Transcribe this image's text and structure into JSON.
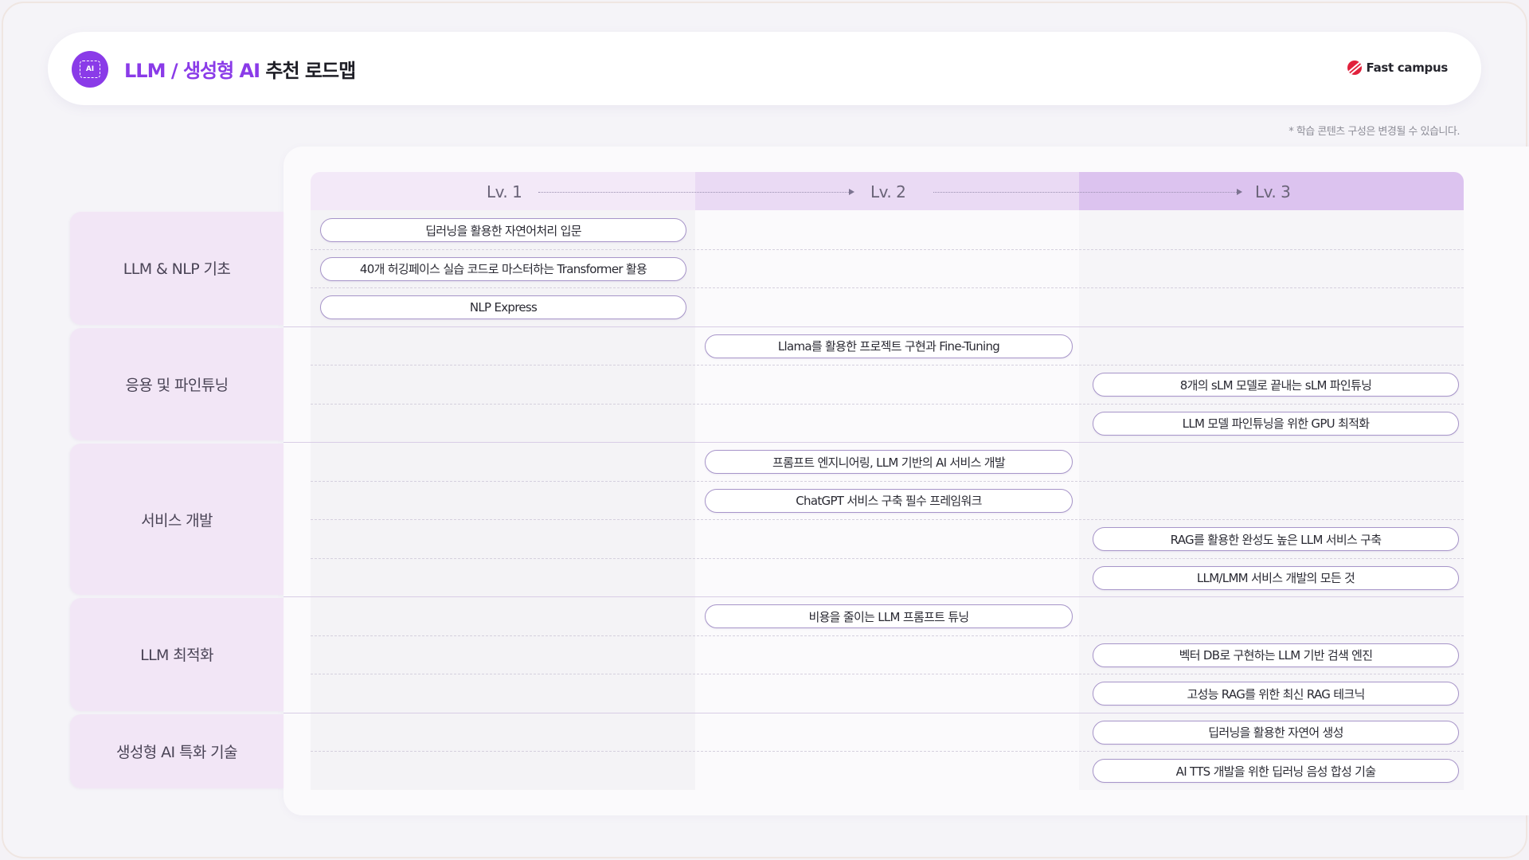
{
  "header": {
    "title_accent": "LLM / 생성형 AI",
    "title_rest": "추천 로드맵",
    "logo_text": "AI",
    "brand": "Fast campus"
  },
  "note": "* 학습 콘텐츠 구성은 변경될 수 있습니다.",
  "levels": [
    "Lv. 1",
    "Lv. 2",
    "Lv. 3"
  ],
  "categories": [
    {
      "label": "LLM & NLP 기초",
      "courses": [
        {
          "label": "딥러닝을 활용한 자연어처리 입문",
          "level": 1
        },
        {
          "label": "40개 허깅페이스 실습 코드로 마스터하는 Transformer 활용",
          "level": 1
        },
        {
          "label": "NLP Express",
          "level": 1
        }
      ]
    },
    {
      "label": "응용 및 파인튜닝",
      "courses": [
        {
          "label": "Llama를 활용한 프로젝트 구현과 Fine-Tuning",
          "level": 2
        },
        {
          "label": "8개의 sLM 모델로 끝내는 sLM 파인튜닝",
          "level": 3
        },
        {
          "label": "LLM 모델 파인튜닝을 위한 GPU 최적화",
          "level": 3
        }
      ]
    },
    {
      "label": "서비스 개발",
      "courses": [
        {
          "label": "프롬프트 엔지니어링, LLM 기반의 AI 서비스 개발",
          "level": 2
        },
        {
          "label": "ChatGPT 서비스 구축 필수 프레임워크",
          "level": 2
        },
        {
          "label": "RAG를 활용한 완성도 높은 LLM 서비스 구축",
          "level": 3
        },
        {
          "label": "LLM/LMM 서비스 개발의 모든 것",
          "level": 3
        }
      ]
    },
    {
      "label": "LLM 최적화",
      "courses": [
        {
          "label": "비용을 줄이는 LLM 프롬프트 튜닝",
          "level": 2
        },
        {
          "label": "벡터 DB로 구현하는 LLM 기반 검색 엔진",
          "level": 3
        },
        {
          "label": "고성능 RAG를 위한 최신 RAG 테크닉",
          "level": 3
        }
      ]
    },
    {
      "label": "생성형 AI 특화 기술",
      "courses": [
        {
          "label": "딥러닝을 활용한 자연어 생성",
          "level": 3
        },
        {
          "label": "AI TTS 개발을 위한 딥러닝 음성 합성 기술",
          "level": 3
        }
      ]
    }
  ],
  "colors": {
    "accent": "#8a3be8",
    "category_bg": "#f2e6f6",
    "pill_border": "#a795c9",
    "level1_bg": "#f3e9f8",
    "level2_bg": "#eadaf4",
    "level3_bg": "#dcc3ef"
  }
}
